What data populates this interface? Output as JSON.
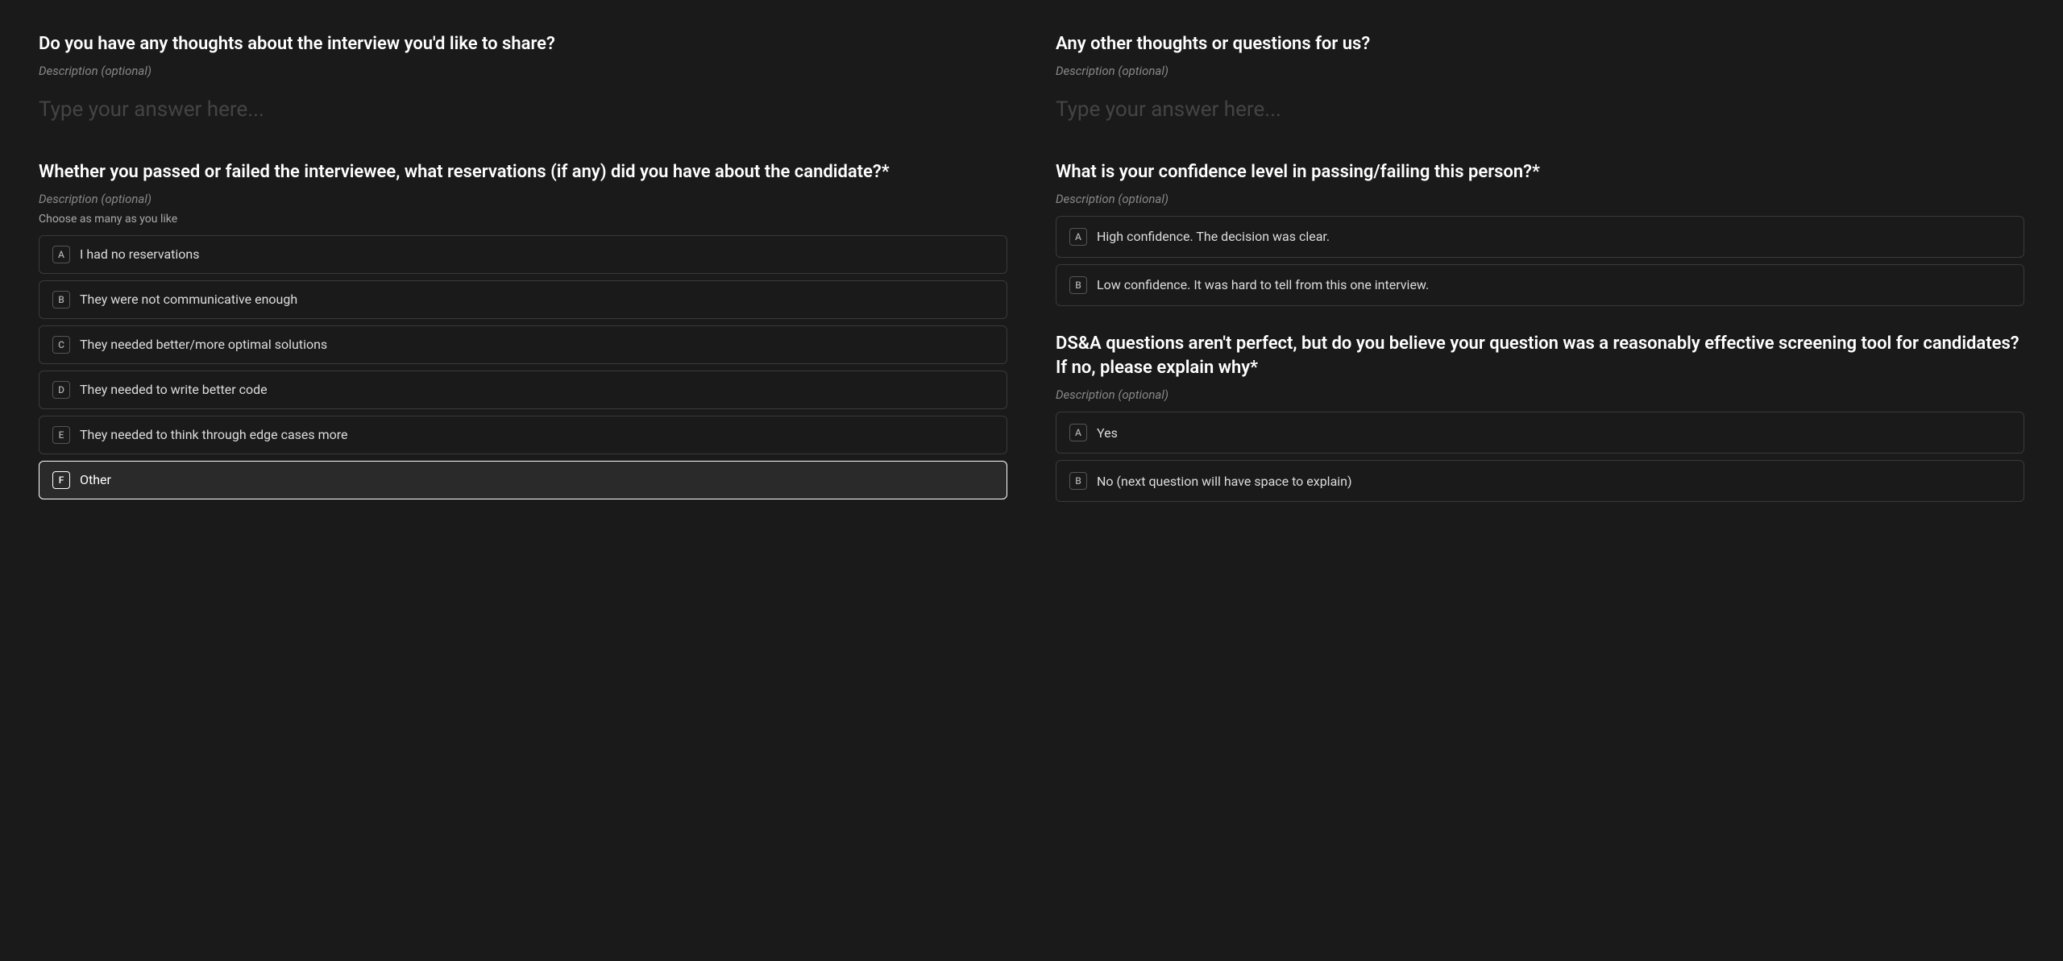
{
  "left_column": {
    "question1": {
      "title": "Do you have any thoughts about the interview you'd like to share?",
      "description": "Description (optional)",
      "placeholder": "Type your answer here..."
    },
    "question2": {
      "title": "Whether you passed or failed the interviewee, what reservations (if any) did you have about the candidate?*",
      "description": "Description (optional)",
      "choose_label": "Choose as many as you like",
      "options": [
        {
          "key": "A",
          "text": "I had no reservations",
          "selected": false
        },
        {
          "key": "B",
          "text": "They were not communicative enough",
          "selected": false
        },
        {
          "key": "C",
          "text": "They needed better/more optimal solutions",
          "selected": false
        },
        {
          "key": "D",
          "text": "They needed to write better code",
          "selected": false
        },
        {
          "key": "E",
          "text": "They needed to think through edge cases more",
          "selected": false
        },
        {
          "key": "F",
          "text": "Other",
          "selected": true
        }
      ]
    }
  },
  "right_column": {
    "question1": {
      "title": "Any other thoughts or questions for us?",
      "description": "Description (optional)",
      "placeholder": "Type your answer here..."
    },
    "question2": {
      "title": "What is your confidence level in passing/failing this person?*",
      "description": "Description (optional)",
      "options": [
        {
          "key": "A",
          "text": "High confidence. The decision was clear."
        },
        {
          "key": "B",
          "text": "Low confidence. It was hard to tell from this one interview."
        }
      ]
    },
    "question3": {
      "title": "DS&A questions aren't perfect, but do you believe your question was a reasonably effective screening tool for candidates? If no, please explain why*",
      "description": "Description (optional)",
      "options": [
        {
          "key": "A",
          "text": "Yes"
        },
        {
          "key": "B",
          "text": "No (next question will have space to explain)"
        }
      ]
    }
  }
}
